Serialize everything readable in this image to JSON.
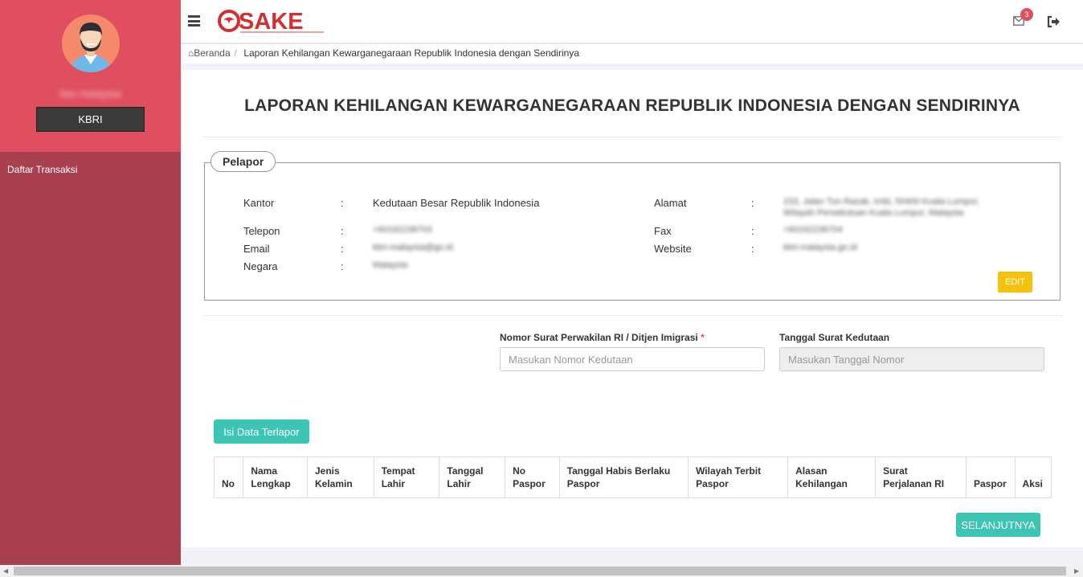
{
  "sidebar": {
    "username": "kbri malaysia",
    "role_button": "KBRI",
    "menu": [
      "Daftar Transaksi"
    ]
  },
  "header": {
    "logo_text": "SAKE",
    "notification_count": "3"
  },
  "breadcrumb": {
    "home": "Beranda",
    "current": "Laporan Kehilangan Kewarganegaraan Republik Indonesia dengan Sendirinya"
  },
  "page": {
    "title": "LAPORAN KEHILANGAN KEWARGANEGARAAN REPUBLIK INDONESIA DENGAN SENDIRINYA"
  },
  "pelapor": {
    "legend": "Pelapor",
    "colon": ":",
    "left": [
      {
        "label": "Kantor",
        "value": "Kedutaan Besar Republik Indonesia"
      },
      {
        "label": "Telepon",
        "value": "+60192238703"
      },
      {
        "label": "Email",
        "value": "kbri-malaysia@go.id"
      },
      {
        "label": "Negara",
        "value": "Malaysia"
      }
    ],
    "right": [
      {
        "label": "Alamat",
        "value_line1": "233, Jalan Tun Razak, Imbi, 50400 Kuala Lumpur,",
        "value_line2": "Wilayah Persekutuan Kuala Lumpur, Malaysia"
      },
      {
        "label": "Fax",
        "value": "+60192238704"
      },
      {
        "label": "Website",
        "value": "kbri-malaysia.go.id"
      }
    ],
    "edit_label": "EDIT"
  },
  "form": {
    "nomor_label": "Nomor Surat Perwakilan RI / Ditjen Imigrasi",
    "required_mark": "*",
    "nomor_placeholder": "Masukan Nomor Kedutaan",
    "tanggal_label": "Tanggal Surat Kedutaan",
    "tanggal_placeholder": "Masukan Tanggal Nomor"
  },
  "actions": {
    "isi_data": "Isi Data Terlapor",
    "next": "SELANJUTNYA"
  },
  "table": {
    "columns": [
      [
        "No"
      ],
      [
        "Nama",
        "Lengkap"
      ],
      [
        "Jenis",
        "Kelamin"
      ],
      [
        "Tempat",
        "Lahir"
      ],
      [
        "Tanggal",
        "Lahir"
      ],
      [
        "No",
        "Paspor"
      ],
      [
        "Tanggal Habis Berlaku",
        "Paspor"
      ],
      [
        "Wilayah Terbit",
        "Paspor"
      ],
      [
        "Alasan",
        "Kehilangan"
      ],
      [
        "Surat",
        "Perjalanan RI"
      ],
      [
        "Paspor"
      ],
      [
        "Aksi"
      ]
    ]
  },
  "colors": {
    "sidebar_top": "#e04f5f",
    "sidebar_bottom": "#a8404f",
    "teal": "#3cc4b4",
    "edit": "#f4c20d"
  }
}
